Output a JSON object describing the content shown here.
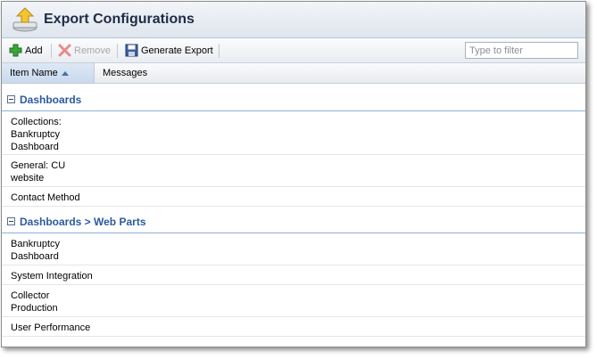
{
  "window": {
    "title": "Export Configurations"
  },
  "toolbar": {
    "add_label": "Add",
    "remove_label": "Remove",
    "generate_label": "Generate Export",
    "filter_placeholder": "Type to filter"
  },
  "columns": {
    "item_name": "Item Name",
    "messages": "Messages"
  },
  "groups": [
    {
      "label": "Dashboards",
      "items": [
        {
          "name": "Collections: Bankruptcy Dashboard",
          "messages": ""
        },
        {
          "name": "General: CU website",
          "messages": ""
        },
        {
          "name": "Contact Method",
          "messages": ""
        }
      ]
    },
    {
      "label": "Dashboards > Web Parts",
      "items": [
        {
          "name": "Bankruptcy Dashboard",
          "messages": ""
        },
        {
          "name": "System Integration",
          "messages": ""
        },
        {
          "name": "Collector Production",
          "messages": ""
        },
        {
          "name": "User Performance",
          "messages": ""
        }
      ]
    }
  ],
  "colors": {
    "group_text": "#2c5a9e",
    "header_bg": "#dfe5ee",
    "group_line": "#8fb0d8"
  },
  "icons": {
    "header": "export-upload-icon",
    "add": "plus-icon",
    "remove": "x-icon",
    "generate": "floppy-disk-icon",
    "collapse": "minus-box-icon"
  }
}
